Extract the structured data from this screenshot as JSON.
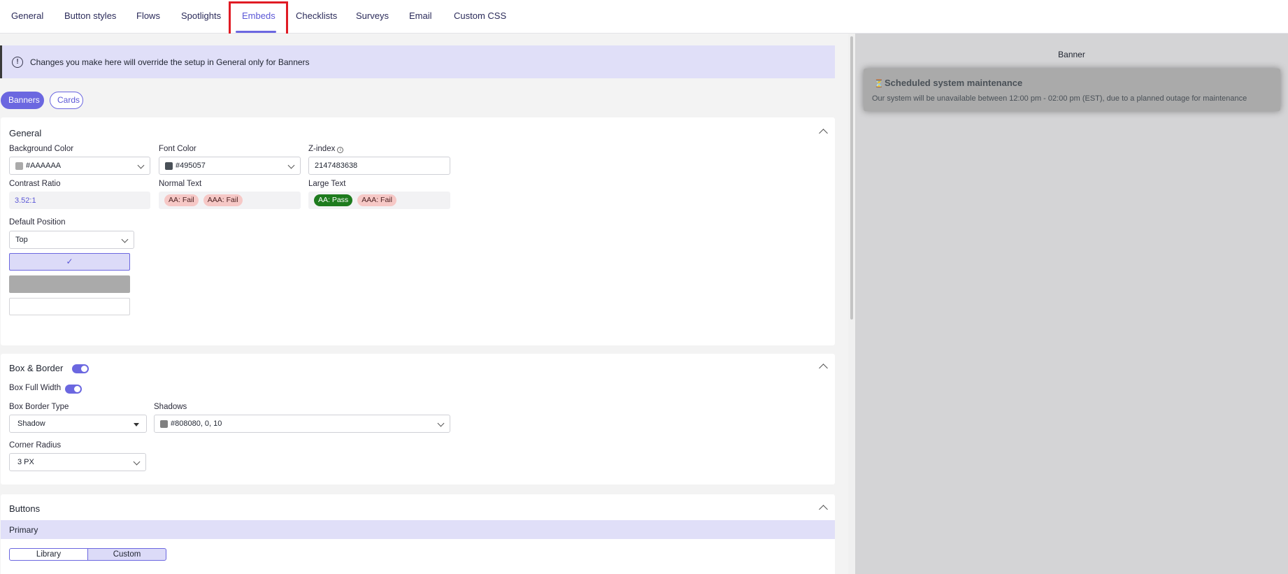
{
  "tabs": [
    {
      "label": "General"
    },
    {
      "label": "Button styles"
    },
    {
      "label": "Flows"
    },
    {
      "label": "Spotlights"
    },
    {
      "label": "Embeds",
      "active": true
    },
    {
      "label": "Checklists"
    },
    {
      "label": "Surveys"
    },
    {
      "label": "Email"
    },
    {
      "label": "Custom CSS"
    }
  ],
  "notice": {
    "text": "Changes you make here will override the setup in General only for Banners",
    "icon": "info-circle-icon"
  },
  "subtabs": {
    "banners": "Banners",
    "cards": "Cards",
    "active": "Banners"
  },
  "general": {
    "title": "General",
    "background_color": {
      "label": "Background Color",
      "value": "#AAAAAA",
      "swatch": "#aaaaaa"
    },
    "font_color": {
      "label": "Font Color",
      "value": "#495057",
      "swatch": "#495057"
    },
    "z_index": {
      "label": "Z-index",
      "value": "2147483638"
    },
    "contrast_ratio": {
      "label": "Contrast Ratio",
      "value": "3.52:1"
    },
    "normal_text": {
      "label": "Normal Text",
      "aa": "AA: Fail",
      "aaa": "AAA: Fail"
    },
    "large_text": {
      "label": "Large Text",
      "aa": "AA: Pass",
      "aaa": "AAA: Fail"
    },
    "default_position": {
      "label": "Default Position",
      "value": "Top",
      "options_check": "✓"
    }
  },
  "box_border": {
    "title": "Box & Border",
    "enabled": true,
    "full_width": {
      "label": "Box Full Width",
      "enabled": true
    },
    "border_type": {
      "label": "Box Border Type",
      "value": "Shadow"
    },
    "shadows": {
      "label": "Shadows",
      "value": "#808080, 0, 10",
      "swatch": "#808080"
    },
    "corner_radius": {
      "label": "Corner Radius",
      "value": "3 PX"
    }
  },
  "buttons": {
    "title": "Buttons",
    "primary_label": "Primary",
    "library": "Library",
    "custom": "Custom",
    "active": "Custom"
  },
  "preview": {
    "title": "Banner",
    "banner": {
      "icon": "⏳",
      "title": "Scheduled system maintenance",
      "text": "Our system will be unavailable between 12:00 pm - 02:00 pm (EST), due to a planned outage for maintenance"
    }
  },
  "colors": {
    "accent": "#6b67e0",
    "notice_bg": "#e0dff8",
    "highlight": "#e01b24"
  }
}
